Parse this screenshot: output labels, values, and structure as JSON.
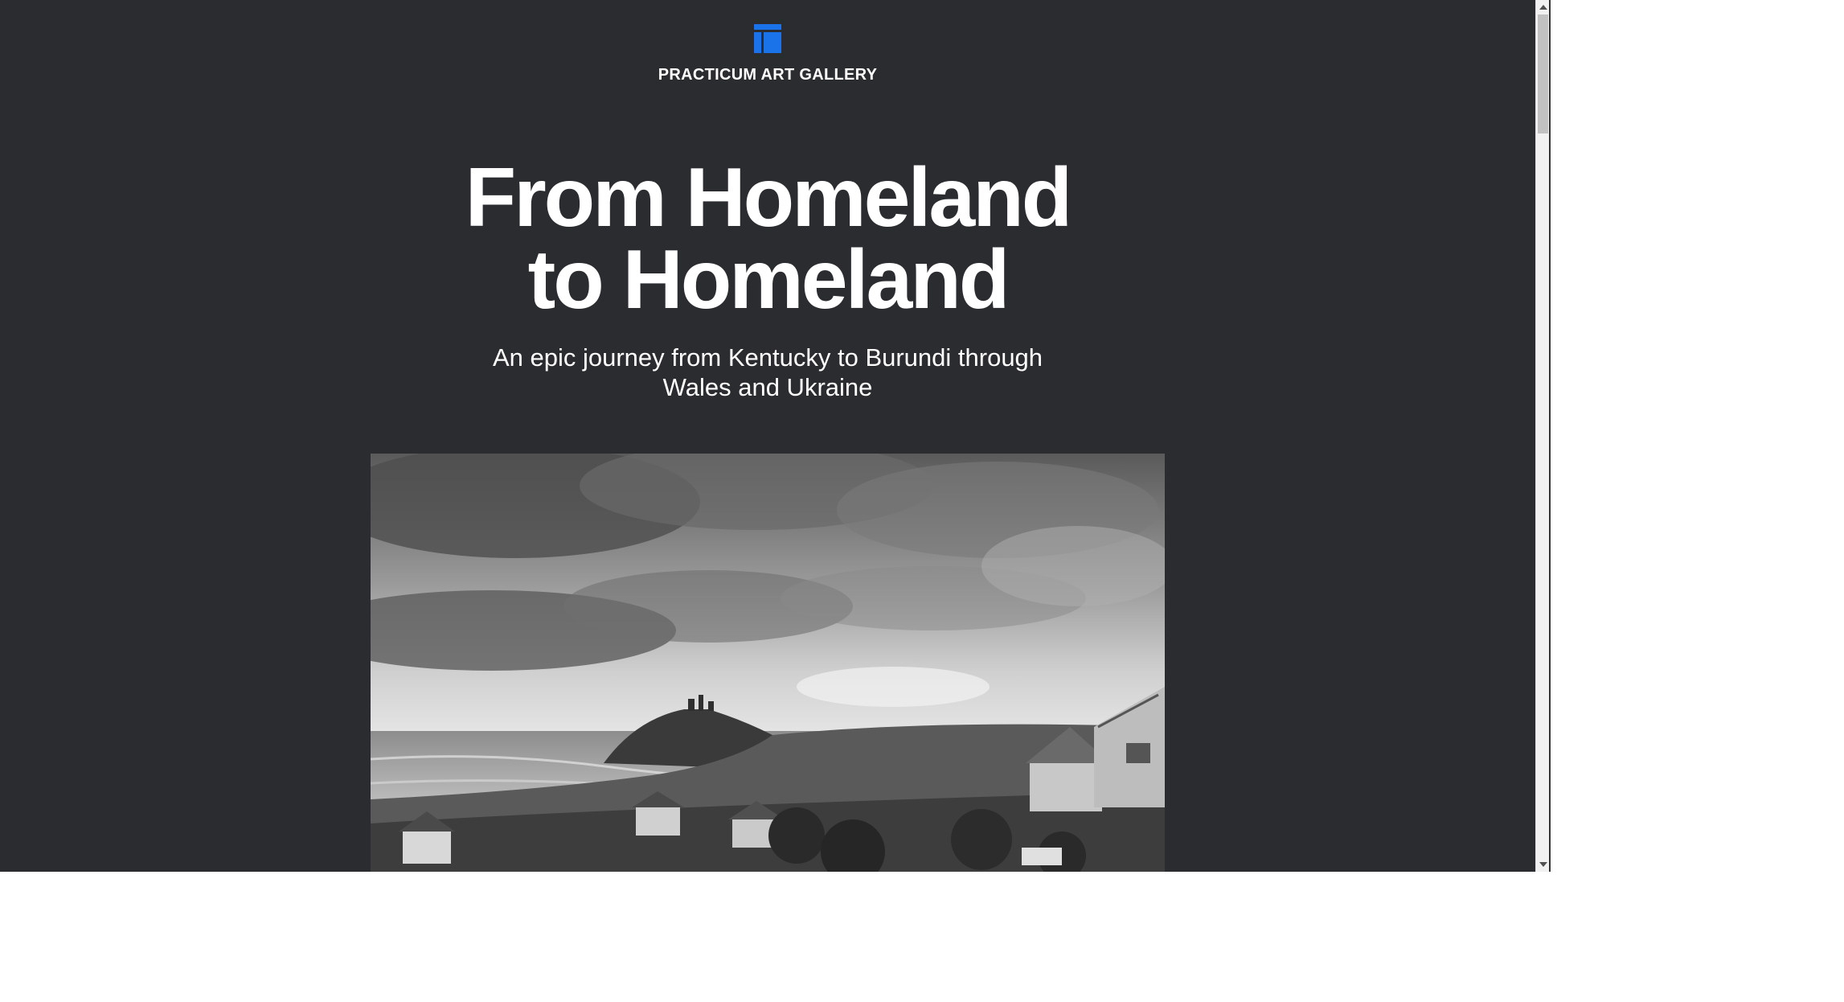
{
  "brand": {
    "logo_icon": "gallery-layout-icon",
    "name": "PRACTICUM ART GALLERY",
    "accent_color": "#1a73e8"
  },
  "hero": {
    "title_line1": "From Homeland",
    "title_line2": "to Homeland",
    "subtitle": "An epic journey from Kentucky to Burundi through Wales and Ukraine"
  },
  "photo": {
    "alt": "Black and white coastal town with castle on hill under cloudy sky"
  },
  "colors": {
    "background": "#2b2c30",
    "text": "#ffffff"
  }
}
